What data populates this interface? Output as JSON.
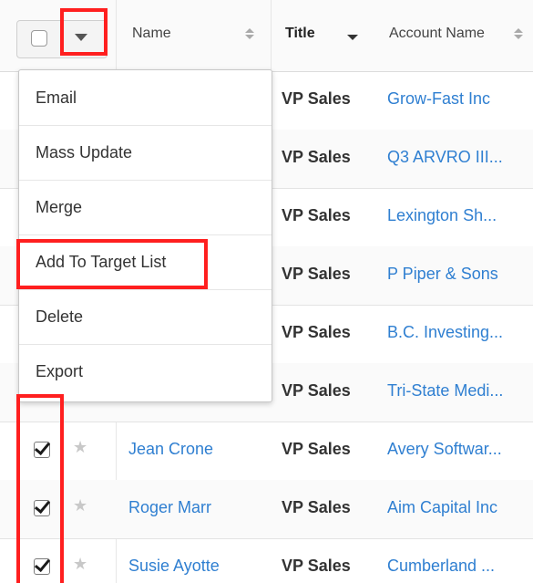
{
  "header": {
    "name_label": "Name",
    "title_label": "Title",
    "account_label": "Account Name"
  },
  "menu": {
    "items": [
      "Email",
      "Mass Update",
      "Merge",
      "Add To Target List",
      "Delete",
      "Export"
    ]
  },
  "rows": [
    {
      "name": "",
      "title": "VP Sales",
      "account": "Grow-Fast Inc",
      "checked": false
    },
    {
      "name": "",
      "title": "VP Sales",
      "account": "Q3 ARVRO III...",
      "checked": false
    },
    {
      "name": "",
      "title": "VP Sales",
      "account": "Lexington Sh...",
      "checked": false
    },
    {
      "name": "",
      "title": "VP Sales",
      "account": "P Piper & Sons",
      "checked": false
    },
    {
      "name": "",
      "title": "VP Sales",
      "account": "B.C. Investing...",
      "checked": false
    },
    {
      "name": "",
      "title": "VP Sales",
      "account": "Tri-State Medi...",
      "checked": false
    },
    {
      "name": "Jean Crone",
      "title": "VP Sales",
      "account": "Avery Softwar...",
      "checked": true
    },
    {
      "name": "Roger Marr",
      "title": "VP Sales",
      "account": "Aim Capital Inc",
      "checked": true
    },
    {
      "name": "Susie Ayotte",
      "title": "VP Sales",
      "account": "Cumberland ...",
      "checked": true
    }
  ],
  "icons": {
    "dropdown": "caret-down-icon",
    "favorite": "star-icon",
    "sort": "sort-arrows-icon"
  },
  "colors": {
    "link": "#2f7fd1",
    "highlight": "#ff1f1f"
  }
}
